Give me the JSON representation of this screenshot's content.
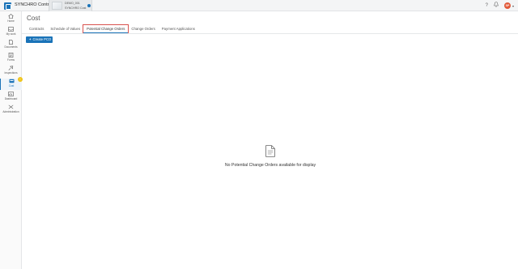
{
  "app": {
    "title": "SYNCHRO Control"
  },
  "project": {
    "line1": "DEMO_001",
    "line2": "SYNCHRO Cost"
  },
  "topbar": {
    "help_icon": "help-icon",
    "notifications_icon": "bell-icon",
    "avatar_initials": "SP"
  },
  "sidebar": {
    "items": [
      {
        "label": "Home",
        "icon": "home-icon"
      },
      {
        "label": "My work",
        "icon": "inbox-icon"
      },
      {
        "label": "Documents",
        "icon": "documents-icon"
      },
      {
        "label": "Forms",
        "icon": "forms-icon"
      },
      {
        "label": "Inspections",
        "icon": "inspections-icon"
      },
      {
        "label": "Cost",
        "icon": "cost-icon",
        "active": true,
        "badge": "!"
      },
      {
        "label": "Dashboard",
        "icon": "dashboard-icon"
      },
      {
        "label": "Administration",
        "icon": "admin-icon"
      }
    ]
  },
  "page": {
    "title": "Cost",
    "tabs": [
      {
        "label": "Contracts"
      },
      {
        "label": "Schedule of Values"
      },
      {
        "label": "Potential Change Orders",
        "active": true
      },
      {
        "label": "Change Orders"
      },
      {
        "label": "Payment Applications"
      }
    ],
    "create_button": "Create PCO",
    "empty_message": "No Potential Change Orders available for display"
  },
  "colors": {
    "accent": "#1a73b8",
    "highlight": "#d9534f",
    "badge": "#f0c419",
    "avatar": "#e15a3a"
  }
}
